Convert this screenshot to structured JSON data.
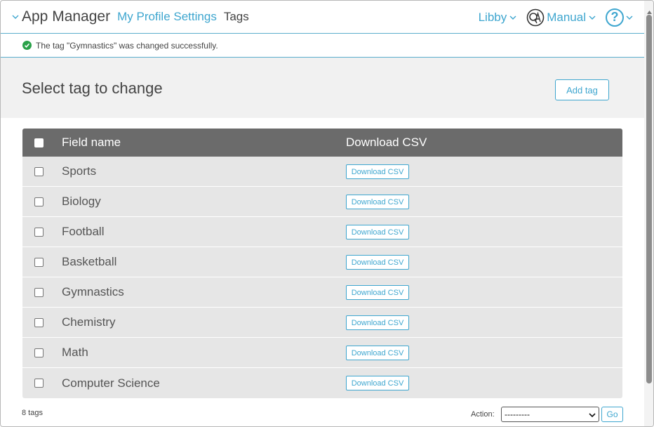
{
  "header": {
    "app_title": "App Manager",
    "breadcrumb_link": "My Profile Settings",
    "breadcrumb_current": "Tags",
    "user_name": "Libby",
    "manual_label": "Manual",
    "help_symbol": "?"
  },
  "message": {
    "text": "The tag \"Gymnastics\" was changed successfully.",
    "status_color": "#2aa149"
  },
  "page": {
    "title": "Select tag to change",
    "add_button": "Add tag"
  },
  "table": {
    "columns": [
      "Field name",
      "Download CSV"
    ],
    "download_label": "Download CSV",
    "rows": [
      {
        "name": "Sports"
      },
      {
        "name": "Biology"
      },
      {
        "name": "Football"
      },
      {
        "name": "Basketball"
      },
      {
        "name": "Gymnastics"
      },
      {
        "name": "Chemistry"
      },
      {
        "name": "Math"
      },
      {
        "name": "Computer Science"
      }
    ]
  },
  "footer": {
    "count": "8 tags",
    "action_label": "Action:",
    "action_selected": "---------",
    "go_label": "Go"
  },
  "colors": {
    "accent": "#3ea6cf",
    "header_row": "#6b6b6b",
    "row_bg": "#e6e6e6"
  }
}
